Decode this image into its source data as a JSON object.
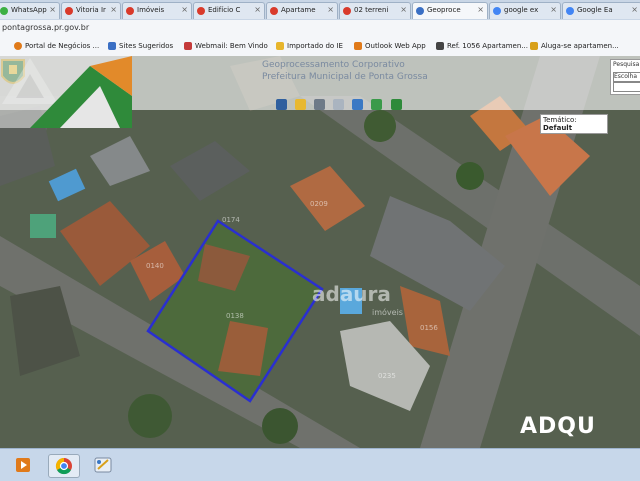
{
  "browser": {
    "tabs": [
      {
        "label": "WhatsApp",
        "icon": "whatsapp-icon",
        "color": "#3cb043"
      },
      {
        "label": "Vitoria Ir",
        "icon": "page-icon",
        "color": "#d93a2b"
      },
      {
        "label": "Imóveis",
        "icon": "page-icon",
        "color": "#d93a2b"
      },
      {
        "label": "Edifício C",
        "icon": "page-icon",
        "color": "#d93a2b"
      },
      {
        "label": "Apartame",
        "icon": "page-icon",
        "color": "#d93a2b"
      },
      {
        "label": "02 terreni",
        "icon": "page-icon",
        "color": "#d93a2b"
      },
      {
        "label": "Geoproce",
        "icon": "globe-icon",
        "color": "#3a6fc4"
      },
      {
        "label": "google ex",
        "icon": "google-icon",
        "color": "#4285f4"
      },
      {
        "label": "Google Ea",
        "icon": "google-icon",
        "color": "#4285f4"
      }
    ],
    "url": "pontagrossa.pr.gov.br",
    "bookmarks": [
      {
        "label": "Portal de Negócios ...",
        "color": "#e07a1a"
      },
      {
        "label": "Sites Sugeridos",
        "color": "#3a6fc4"
      },
      {
        "label": "Webmail: Bem Vindo",
        "color": "#c43a3a"
      },
      {
        "label": "Importado do IE",
        "color": "#e7b52c"
      },
      {
        "label": "Outlook Web App",
        "color": "#e07a1a"
      },
      {
        "label": "Ref. 1056 Apartamen...",
        "color": "#444444"
      },
      {
        "label": "Aluga-se apartamen...",
        "color": "#d8a01a"
      }
    ]
  },
  "map": {
    "header": {
      "title": "Geoprocessamento Corporativo",
      "subtitle": "Prefeitura Municipal de Ponta Grossa"
    },
    "toolbar_icons": [
      "zoom-in-icon",
      "home-icon",
      "pan-icon",
      "measure-icon",
      "layers-icon",
      "info-icon",
      "print-icon"
    ],
    "pesquisa": {
      "label": "Pesquisa",
      "select_value": "Escolha"
    },
    "tematico": {
      "label": "Temático:",
      "value": "Default"
    },
    "watermark": {
      "text": "adaura",
      "subtitle": "imóveis"
    },
    "brand": {
      "text": "ADQU"
    },
    "lot_numbers": [
      "0174",
      "0138",
      "0209",
      "0156",
      "0235",
      "0140"
    ],
    "colors": {
      "boundary": "#2a2fd0",
      "brand_green": "#2f8a3a",
      "brand_orange": "#e28a2a"
    }
  },
  "taskbar": {
    "items": [
      {
        "name": "media-player-icon"
      },
      {
        "name": "chrome-icon"
      },
      {
        "name": "paint-icon"
      }
    ]
  }
}
